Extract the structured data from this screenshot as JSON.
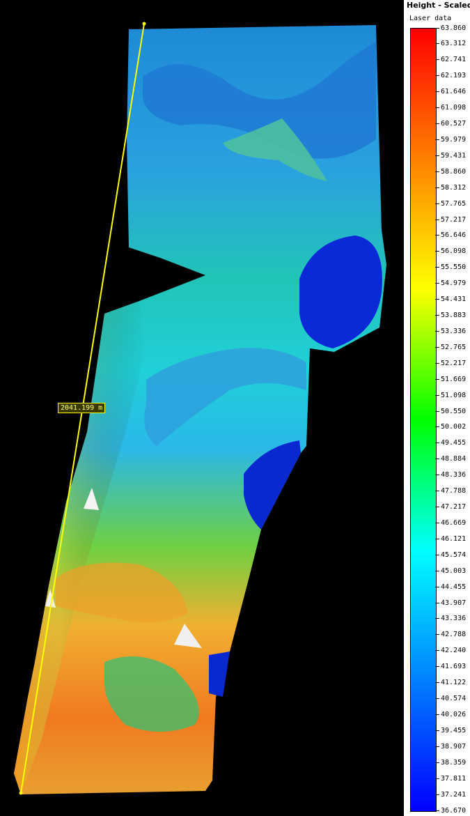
{
  "legend": {
    "title": "Height - Scaled",
    "subtitle": "Laser data",
    "ticks": [
      "63.860",
      "63.312",
      "62.741",
      "62.193",
      "61.646",
      "61.098",
      "60.527",
      "59.979",
      "59.431",
      "58.860",
      "58.312",
      "57.765",
      "57.217",
      "56.646",
      "56.098",
      "55.550",
      "54.979",
      "54.431",
      "53.883",
      "53.336",
      "52.765",
      "52.217",
      "51.669",
      "51.098",
      "50.550",
      "50.002",
      "49.455",
      "48.884",
      "48.336",
      "47.788",
      "47.217",
      "46.669",
      "46.121",
      "45.574",
      "45.003",
      "44.455",
      "43.907",
      "43.336",
      "42.788",
      "42.240",
      "41.693",
      "41.122",
      "40.574",
      "40.026",
      "39.455",
      "38.907",
      "38.359",
      "37.811",
      "37.241",
      "36.670"
    ],
    "ramp_colors": [
      "#ff0000",
      "#ff8000",
      "#ffff00",
      "#00ff00",
      "#00ffff",
      "#0080ff",
      "#0000ff"
    ]
  },
  "measurement": {
    "label": "2041.199 m",
    "color": "#ffff00"
  }
}
